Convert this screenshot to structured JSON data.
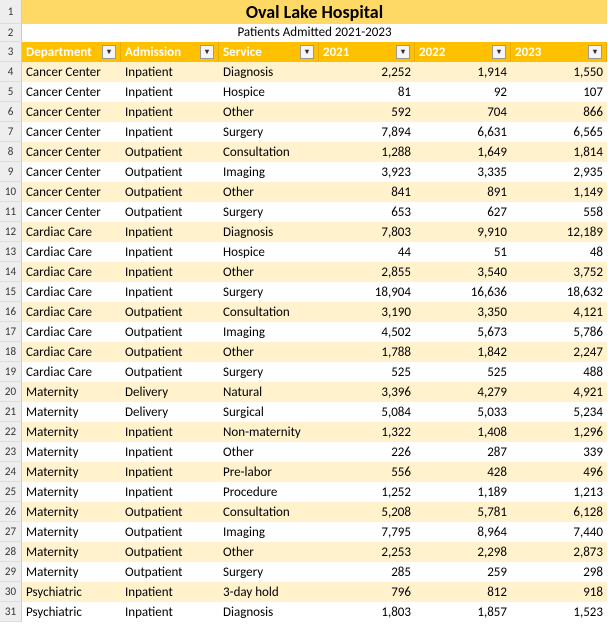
{
  "title": "Oval Lake Hospital",
  "subtitle": "Patients Admitted 2021-2023",
  "columns": [
    "Department",
    "Admission",
    "Service",
    "2021",
    "2022",
    "2023"
  ],
  "row_numbers": [
    1,
    2,
    3,
    4,
    5,
    6,
    7,
    8,
    9,
    10,
    11,
    12,
    13,
    14,
    15,
    16,
    17,
    18,
    19,
    20,
    21,
    22,
    23,
    24,
    25,
    26,
    27,
    28,
    29,
    30,
    31
  ],
  "rows": [
    {
      "department": "Cancer Center",
      "admission": "Inpatient",
      "service": "Diagnosis",
      "y2021": "2,252",
      "y2022": "1,914",
      "y2023": "1,550"
    },
    {
      "department": "Cancer Center",
      "admission": "Inpatient",
      "service": "Hospice",
      "y2021": "81",
      "y2022": "92",
      "y2023": "107"
    },
    {
      "department": "Cancer Center",
      "admission": "Inpatient",
      "service": "Other",
      "y2021": "592",
      "y2022": "704",
      "y2023": "866"
    },
    {
      "department": "Cancer Center",
      "admission": "Inpatient",
      "service": "Surgery",
      "y2021": "7,894",
      "y2022": "6,631",
      "y2023": "6,565"
    },
    {
      "department": "Cancer Center",
      "admission": "Outpatient",
      "service": "Consultation",
      "y2021": "1,288",
      "y2022": "1,649",
      "y2023": "1,814"
    },
    {
      "department": "Cancer Center",
      "admission": "Outpatient",
      "service": "Imaging",
      "y2021": "3,923",
      "y2022": "3,335",
      "y2023": "2,935"
    },
    {
      "department": "Cancer Center",
      "admission": "Outpatient",
      "service": "Other",
      "y2021": "841",
      "y2022": "891",
      "y2023": "1,149"
    },
    {
      "department": "Cancer Center",
      "admission": "Outpatient",
      "service": "Surgery",
      "y2021": "653",
      "y2022": "627",
      "y2023": "558"
    },
    {
      "department": "Cardiac Care",
      "admission": "Inpatient",
      "service": "Diagnosis",
      "y2021": "7,803",
      "y2022": "9,910",
      "y2023": "12,189"
    },
    {
      "department": "Cardiac Care",
      "admission": "Inpatient",
      "service": "Hospice",
      "y2021": "44",
      "y2022": "51",
      "y2023": "48"
    },
    {
      "department": "Cardiac Care",
      "admission": "Inpatient",
      "service": "Other",
      "y2021": "2,855",
      "y2022": "3,540",
      "y2023": "3,752"
    },
    {
      "department": "Cardiac Care",
      "admission": "Inpatient",
      "service": "Surgery",
      "y2021": "18,904",
      "y2022": "16,636",
      "y2023": "18,632"
    },
    {
      "department": "Cardiac Care",
      "admission": "Outpatient",
      "service": "Consultation",
      "y2021": "3,190",
      "y2022": "3,350",
      "y2023": "4,121"
    },
    {
      "department": "Cardiac Care",
      "admission": "Outpatient",
      "service": "Imaging",
      "y2021": "4,502",
      "y2022": "5,673",
      "y2023": "5,786"
    },
    {
      "department": "Cardiac Care",
      "admission": "Outpatient",
      "service": "Other",
      "y2021": "1,788",
      "y2022": "1,842",
      "y2023": "2,247"
    },
    {
      "department": "Cardiac Care",
      "admission": "Outpatient",
      "service": "Surgery",
      "y2021": "525",
      "y2022": "525",
      "y2023": "488"
    },
    {
      "department": "Maternity",
      "admission": "Delivery",
      "service": "Natural",
      "y2021": "3,396",
      "y2022": "4,279",
      "y2023": "4,921"
    },
    {
      "department": "Maternity",
      "admission": "Delivery",
      "service": "Surgical",
      "y2021": "5,084",
      "y2022": "5,033",
      "y2023": "5,234"
    },
    {
      "department": "Maternity",
      "admission": "Inpatient",
      "service": "Non-maternity",
      "y2021": "1,322",
      "y2022": "1,408",
      "y2023": "1,296"
    },
    {
      "department": "Maternity",
      "admission": "Inpatient",
      "service": "Other",
      "y2021": "226",
      "y2022": "287",
      "y2023": "339"
    },
    {
      "department": "Maternity",
      "admission": "Inpatient",
      "service": "Pre-labor",
      "y2021": "556",
      "y2022": "428",
      "y2023": "496"
    },
    {
      "department": "Maternity",
      "admission": "Inpatient",
      "service": "Procedure",
      "y2021": "1,252",
      "y2022": "1,189",
      "y2023": "1,213"
    },
    {
      "department": "Maternity",
      "admission": "Outpatient",
      "service": "Consultation",
      "y2021": "5,208",
      "y2022": "5,781",
      "y2023": "6,128"
    },
    {
      "department": "Maternity",
      "admission": "Outpatient",
      "service": "Imaging",
      "y2021": "7,795",
      "y2022": "8,964",
      "y2023": "7,440"
    },
    {
      "department": "Maternity",
      "admission": "Outpatient",
      "service": "Other",
      "y2021": "2,253",
      "y2022": "2,298",
      "y2023": "2,873"
    },
    {
      "department": "Maternity",
      "admission": "Outpatient",
      "service": "Surgery",
      "y2021": "285",
      "y2022": "259",
      "y2023": "298"
    },
    {
      "department": "Psychiatric",
      "admission": "Inpatient",
      "service": "3-day hold",
      "y2021": "796",
      "y2022": "812",
      "y2023": "918"
    },
    {
      "department": "Psychiatric",
      "admission": "Inpatient",
      "service": "Diagnosis",
      "y2021": "1,803",
      "y2022": "1,857",
      "y2023": "1,523"
    }
  ]
}
